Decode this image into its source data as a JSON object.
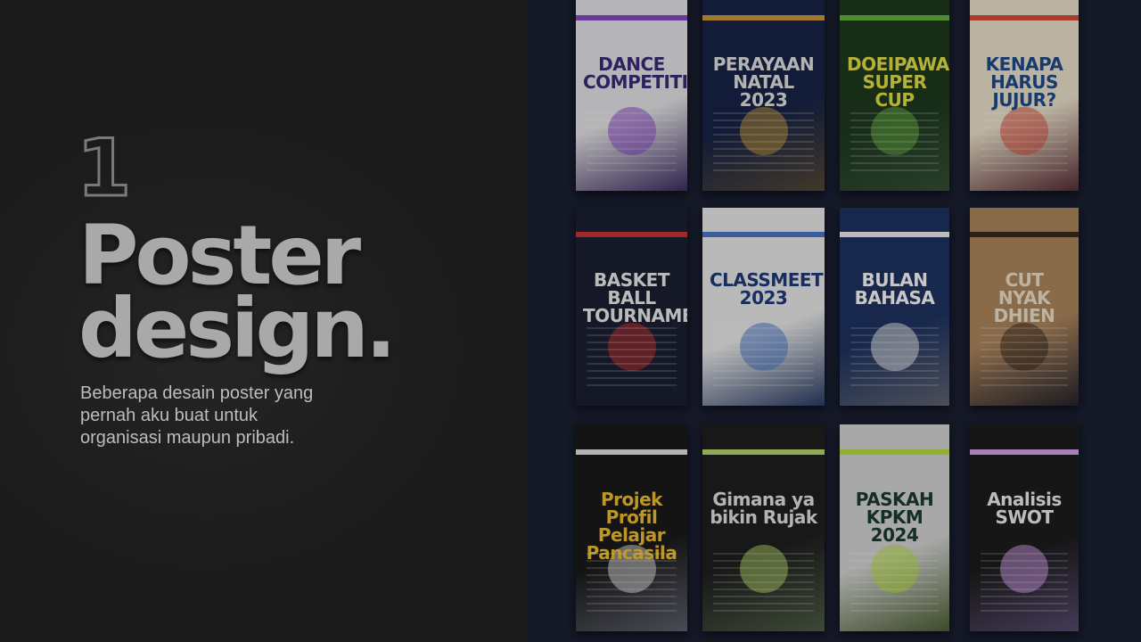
{
  "hero": {
    "number": "1",
    "title_line1": "Poster",
    "title_line2": "design.",
    "description": "Beberapa desain poster yang pernah aku buat untuk organisasi maupun pribadi."
  },
  "posters": [
    {
      "name": "poster-dance-competition",
      "text": "DANCE COMPETITION",
      "bg": "#e8e8ea",
      "fg": "#3b2a77",
      "accent": "#8a49c8"
    },
    {
      "name": "poster-perayaan-natal",
      "text": "PERAYAAN NATAL 2023",
      "bg": "#172346",
      "fg": "#e6e6e6",
      "accent": "#c99a3a"
    },
    {
      "name": "poster-doeipawa-super-cup",
      "text": "DOEIPAWA SUPER CUP",
      "bg": "#1d3a1e",
      "fg": "#e6e34a",
      "accent": "#6bb243"
    },
    {
      "name": "poster-anti-korupsi",
      "text": "KENAPA HARUS JUJUR?",
      "bg": "#f0e6cf",
      "fg": "#1f4c8c",
      "accent": "#d94b3a"
    },
    {
      "name": "poster-basketball-tournament",
      "text": "BASKET BALL TOURNAMENT",
      "bg": "#2d2c63",
      "fg": "#f0f0f0",
      "accent": "#c33"
    },
    {
      "name": "poster-classmeet-2023",
      "text": "CLASSMEET 2023",
      "bg": "#ededed",
      "fg": "#1e3b78",
      "accent": "#4a78c9"
    },
    {
      "name": "poster-bulan-bahasa",
      "text": "BULAN BAHASA",
      "bg": "#1d3362",
      "fg": "#ffffff",
      "accent": "#f1f1f1"
    },
    {
      "name": "poster-biografi-cut-nyak-dhien",
      "text": "CUT NYAK DHIEN",
      "bg": "#b0885e",
      "fg": "#f2e6d0",
      "accent": "#3b2a1e"
    },
    {
      "name": "poster-projek-profil-pancasila",
      "text": "Projek Profil Pelajar Pancasila",
      "bg": "#1a1a1a",
      "fg": "#f1c232",
      "accent": "#e6e6e6"
    },
    {
      "name": "poster-rujak",
      "text": "Gimana ya bikin Rujak",
      "bg": "#1f1f1f",
      "fg": "#e6e6e6",
      "accent": "#b7d96c"
    },
    {
      "name": "poster-paskah-kpkm-2024",
      "text": "PASKAH KPKM 2024",
      "bg": "#d8d8d8",
      "fg": "#1b3b2b",
      "accent": "#b6e23a"
    },
    {
      "name": "poster-analisis-swot",
      "text": "Analisis SWOT",
      "bg": "#1c1c1c",
      "fg": "#f1f1f1",
      "accent": "#d9a2f0"
    }
  ]
}
